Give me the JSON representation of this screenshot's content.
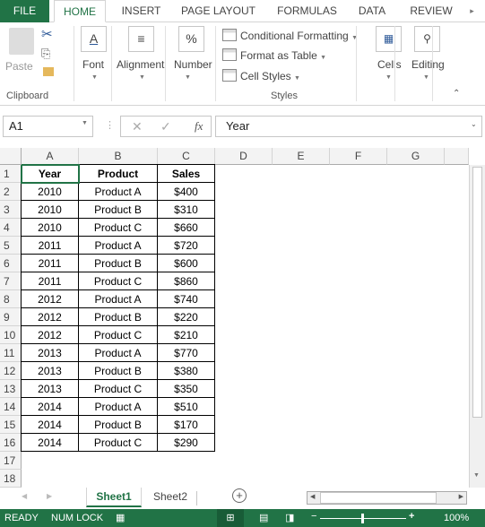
{
  "ribbon_tabs": [
    "FILE",
    "HOME",
    "INSERT",
    "PAGE LAYOUT",
    "FORMULAS",
    "DATA",
    "REVIEW"
  ],
  "clipboard": {
    "paste": "Paste",
    "group": "Clipboard"
  },
  "font": "Font",
  "alignment": "Alignment",
  "number": "Number",
  "styles": {
    "conditional": "Conditional Formatting",
    "format_table": "Format as Table",
    "cell_styles": "Cell Styles",
    "group": "Styles"
  },
  "cells": "Cells",
  "editing": "Editing",
  "formula_bar": {
    "name_box": "A1",
    "fx": "fx",
    "value": "Year"
  },
  "columns": [
    "A",
    "B",
    "C",
    "D",
    "E",
    "F",
    "G"
  ],
  "rows": [
    "1",
    "2",
    "3",
    "4",
    "5",
    "6",
    "7",
    "8",
    "9",
    "10",
    "11",
    "12",
    "13",
    "14",
    "15",
    "16",
    "17",
    "18"
  ],
  "table": {
    "headers": [
      "Year",
      "Product",
      "Sales"
    ],
    "rows": [
      [
        "2010",
        "Product A",
        "$400"
      ],
      [
        "2010",
        "Product B",
        "$310"
      ],
      [
        "2010",
        "Product C",
        "$660"
      ],
      [
        "2011",
        "Product A",
        "$720"
      ],
      [
        "2011",
        "Product B",
        "$600"
      ],
      [
        "2011",
        "Product C",
        "$860"
      ],
      [
        "2012",
        "Product A",
        "$740"
      ],
      [
        "2012",
        "Product B",
        "$220"
      ],
      [
        "2012",
        "Product C",
        "$210"
      ],
      [
        "2013",
        "Product A",
        "$770"
      ],
      [
        "2013",
        "Product B",
        "$380"
      ],
      [
        "2013",
        "Product C",
        "$350"
      ],
      [
        "2014",
        "Product A",
        "$510"
      ],
      [
        "2014",
        "Product B",
        "$170"
      ],
      [
        "2014",
        "Product C",
        "$290"
      ]
    ]
  },
  "sheets": [
    "Sheet1",
    "Sheet2"
  ],
  "active_sheet": "Sheet1",
  "status": {
    "ready": "READY",
    "numlock": "NUM LOCK",
    "zoom": "100%"
  },
  "colors": {
    "accent": "#217346"
  }
}
